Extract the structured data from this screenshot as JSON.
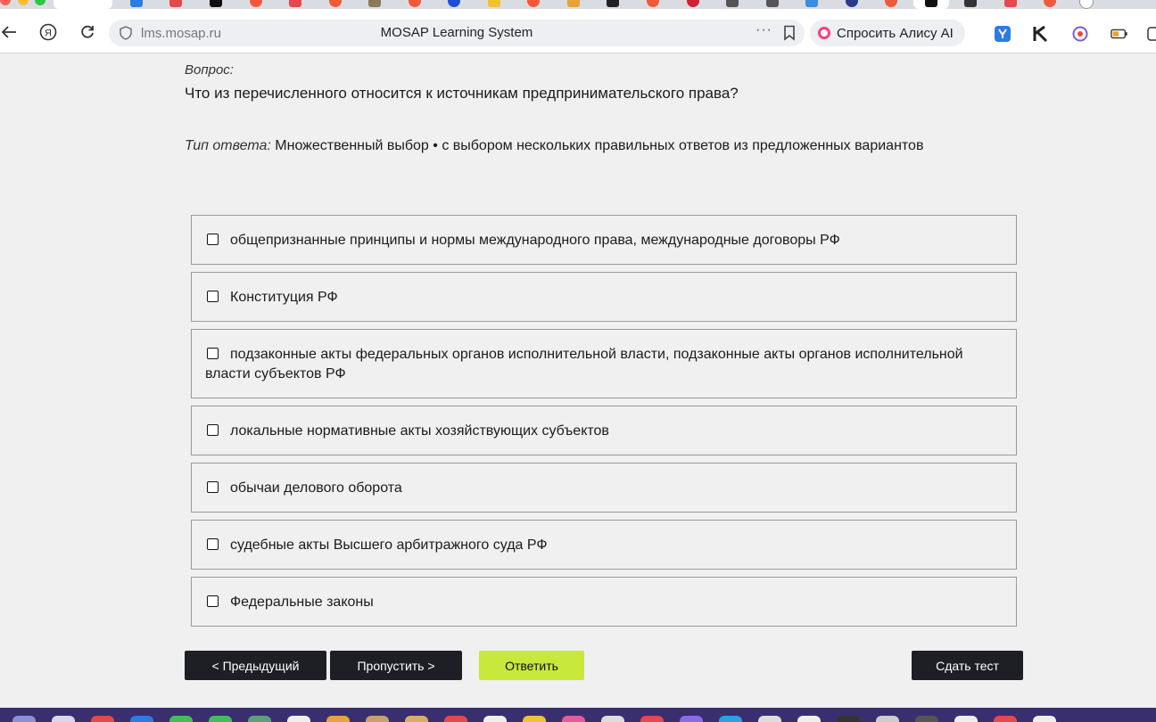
{
  "browser": {
    "url_host": "lms.mosap.ru",
    "page_title": "MOSAP Learning System",
    "alice_label": "Спросить Алису AI",
    "icons": {
      "back": "back-arrow-icon",
      "yandex": "yandex-icon",
      "reload": "reload-icon",
      "site_info": "shield-icon",
      "menu": "more-dots-icon",
      "bookmark": "bookmark-icon"
    }
  },
  "question": {
    "label": "Вопрос:",
    "text": "Что из перечисленного относится к источникам предпринимательского права?",
    "type_label": "Тип ответа:",
    "type_value": "Множественный выбор • с выбором нескольких правильных ответов из предложенных вариантов"
  },
  "options": [
    "общепризнанные принципы и нормы международного права, международные договоры РФ",
    "Конституция РФ",
    "подзаконные акты федеральных органов исполнительной власти, подзаконные акты органов исполнительной власти субъектов РФ",
    "локальные нормативные акты хозяйствующих субъектов",
    "обычаи делового оборота",
    "судебные акты Высшего арбитражного суда РФ",
    "Федеральные законы"
  ],
  "buttons": {
    "prev": "< Предыдущий",
    "skip": "Пропустить >",
    "answer": "Ответить",
    "submit": "Сдать тест"
  },
  "colors": {
    "accent_lime": "#c8e83c",
    "button_dark": "#1d1f25",
    "page_bg": "#f0f0f0"
  }
}
